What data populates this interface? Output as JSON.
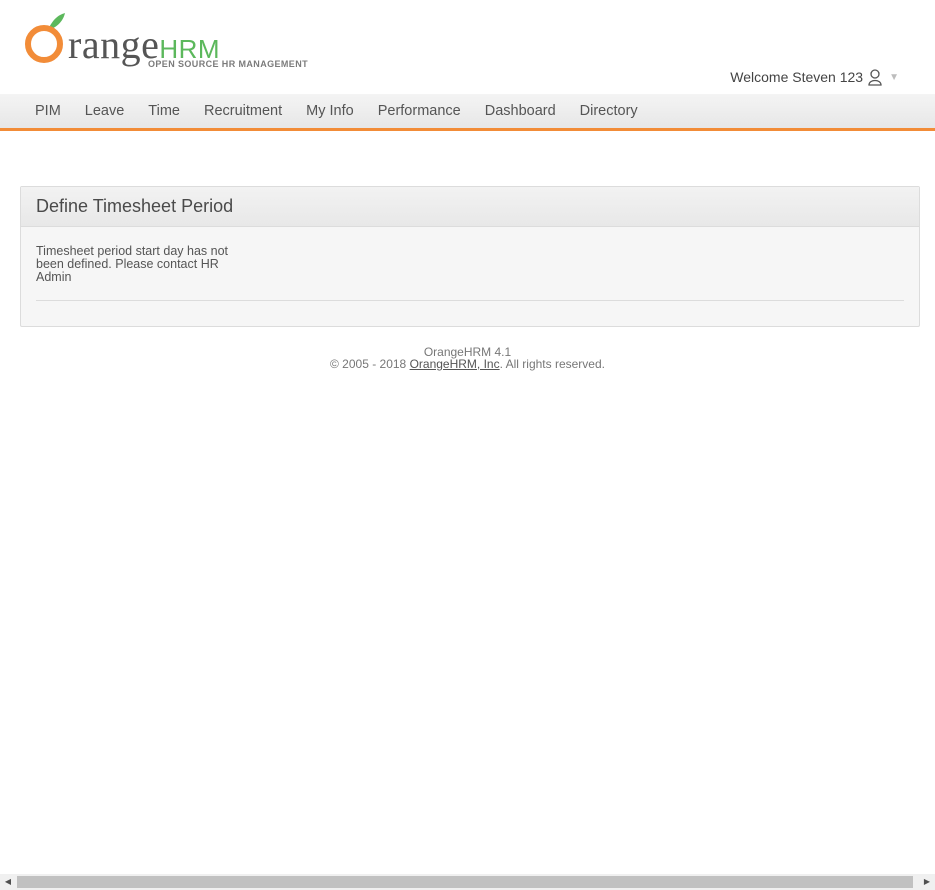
{
  "header": {
    "logo_word": "range",
    "logo_hrm": "HRM",
    "logo_tagline": "OPEN SOURCE HR MANAGEMENT",
    "welcome_text": "Welcome Steven 123"
  },
  "nav": {
    "items": [
      {
        "label": "PIM"
      },
      {
        "label": "Leave"
      },
      {
        "label": "Time"
      },
      {
        "label": "Recruitment"
      },
      {
        "label": "My Info"
      },
      {
        "label": "Performance"
      },
      {
        "label": "Dashboard"
      },
      {
        "label": "Directory"
      }
    ]
  },
  "panel": {
    "title": "Define Timesheet Period",
    "message": "Timesheet period start day has not been defined. Please contact HR Admin"
  },
  "footer": {
    "version": "OrangeHRM 4.1",
    "copyright_prefix": "© 2005 - 2018 ",
    "company_link": "OrangeHRM, Inc",
    "copyright_suffix": ". All rights reserved."
  },
  "colors": {
    "accent": "#f28c38",
    "logo_green": "#5cb85c"
  }
}
